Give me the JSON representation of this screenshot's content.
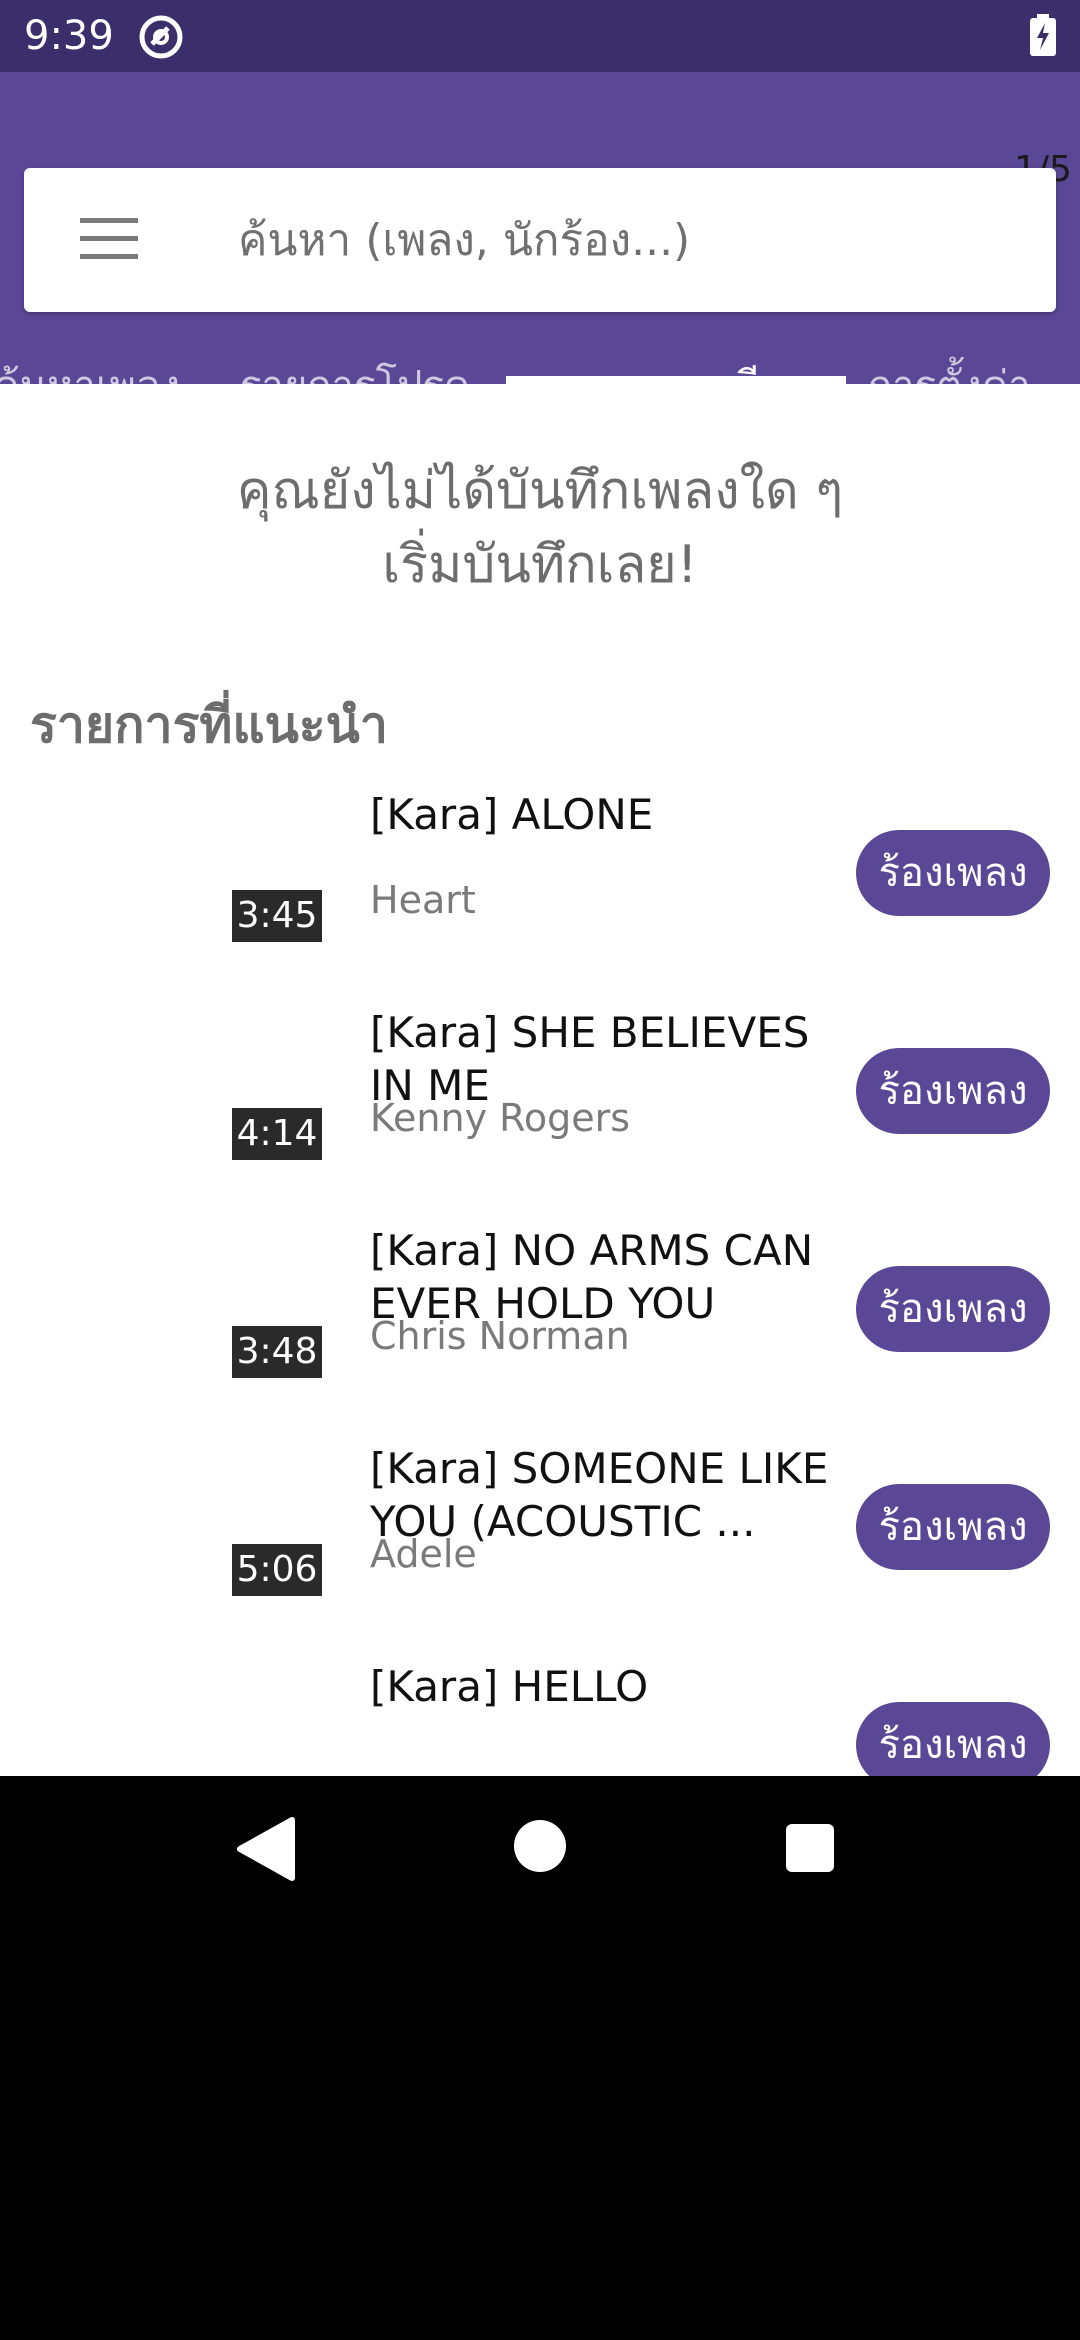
{
  "status_bar": {
    "time": "9:39"
  },
  "page_indicator": "1/5",
  "search": {
    "placeholder": "ค้นหา (เพลง, นักร้อง...)"
  },
  "tabs": [
    {
      "label": "ค้นหาเพลง"
    },
    {
      "label": "รายการโปรด"
    },
    {
      "label": "รายการระเบียน"
    },
    {
      "label": "การตั้งค่า"
    }
  ],
  "active_tab": "รายการระเบียน",
  "empty_state": {
    "line1": "คุณยังไม่ได้บันทึกเพลงใด ๆ",
    "line2": "เริ่มบันทึกเลย!"
  },
  "recommended": {
    "title": "รายการที่แนะนำ",
    "songs": [
      {
        "title": "[Kara] ALONE",
        "artist": "Heart",
        "duration": "3:45",
        "action": "ร้องเพลง"
      },
      {
        "title": "[Kara] SHE BELIEVES IN ME",
        "artist": "Kenny Rogers",
        "duration": "4:14",
        "action": "ร้องเพลง"
      },
      {
        "title": "[Kara] NO ARMS CAN EVER HOLD YOU",
        "artist": "Chris Norman",
        "duration": "3:48",
        "action": "ร้องเพลง"
      },
      {
        "title": "[Kara] SOMEONE LIKE YOU (ACOUSTIC ...",
        "artist": "Adele",
        "duration": "5:06",
        "action": "ร้องเพลง"
      },
      {
        "title": "[Kara] HELLO",
        "artist": "",
        "duration": "",
        "action": "ร้องเพลง"
      }
    ]
  },
  "colors": {
    "primary": "#5a4796",
    "status_bar": "#3b2f6b"
  },
  "icons": {
    "menu": "hamburger-menu-icon",
    "status_app": "at-circle-icon",
    "battery": "battery-charging-icon",
    "nav_back": "triangle-back-icon",
    "nav_home": "circle-home-icon",
    "nav_recent": "square-recent-icon"
  }
}
